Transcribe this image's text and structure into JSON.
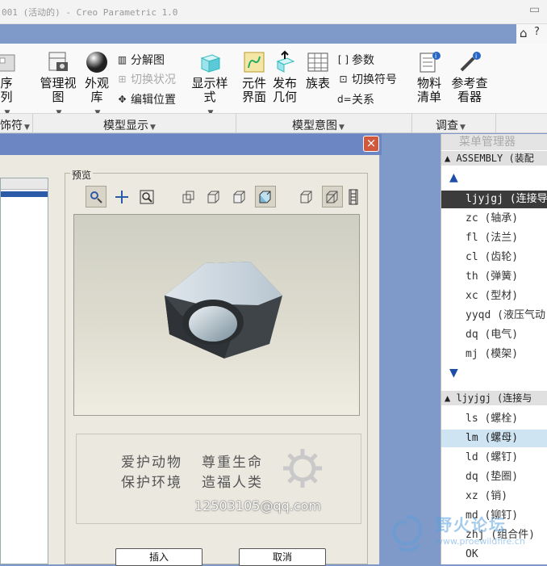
{
  "window": {
    "title": "001 (活动的) - Creo Parametric 1.0",
    "min_glyph": "▭",
    "help_glyph": "⌂",
    "expand_glyph": "?"
  },
  "ribbon": {
    "partial_left_label": "序列",
    "manage_views": "管理视图",
    "appearance_lib": "外观库",
    "explode_view": "分解图",
    "toggle_state": "切换状况",
    "edit_position": "编辑位置",
    "display_style": "显示样式",
    "element_ui": "元件界面",
    "publish_geom": "发布几何",
    "family_table": "族表",
    "parameters": "参数",
    "toggle_symbol": "切换符号",
    "relations": "关系",
    "bom": "物料清单",
    "ref_viewer": "参考查看器",
    "params_prefix": "[ ]",
    "relations_prefix": "d="
  },
  "groups": {
    "g0": "饰符",
    "g1": "模型显示",
    "g2": "模型意图",
    "g3": "调查"
  },
  "dialog": {
    "close": "×",
    "preview_label": "预览",
    "slogan_line1_a": "爱护动物",
    "slogan_line1_b": "尊重生命",
    "slogan_line2_a": "保护环境",
    "slogan_line2_b": "造福人类",
    "email": "12503105@qq.com",
    "insert_button": "插入",
    "cancel_button": "取消"
  },
  "menu_manager": {
    "title": "菜单管理器",
    "section1": "▲ ASSEMBLY (装配",
    "up_arrow": "▲",
    "down_arrow": "▼",
    "items1": [
      "ljyjgj (连接导",
      "zc (轴承)",
      "fl (法兰)",
      "cl (齿轮)",
      "th (弹簧)",
      "xc (型材)",
      "yyqd (液压气动",
      "dq (电气)",
      "mj (模架)"
    ],
    "section2": "▲ ljyjgj (连接与",
    "items2": [
      "ls (螺栓)",
      "lm (螺母)",
      "ld (螺钉)",
      "dq (垫圈)",
      "xz (销)",
      "md (铆钉)",
      "zhj (组合件)",
      "OK"
    ]
  },
  "watermark": {
    "text": "野火论坛",
    "url": "www.proewildfire.cn"
  },
  "colors": {
    "accent": "#1e4fa8",
    "dialog_title": "#6b86c3",
    "close": "#d1583d"
  }
}
